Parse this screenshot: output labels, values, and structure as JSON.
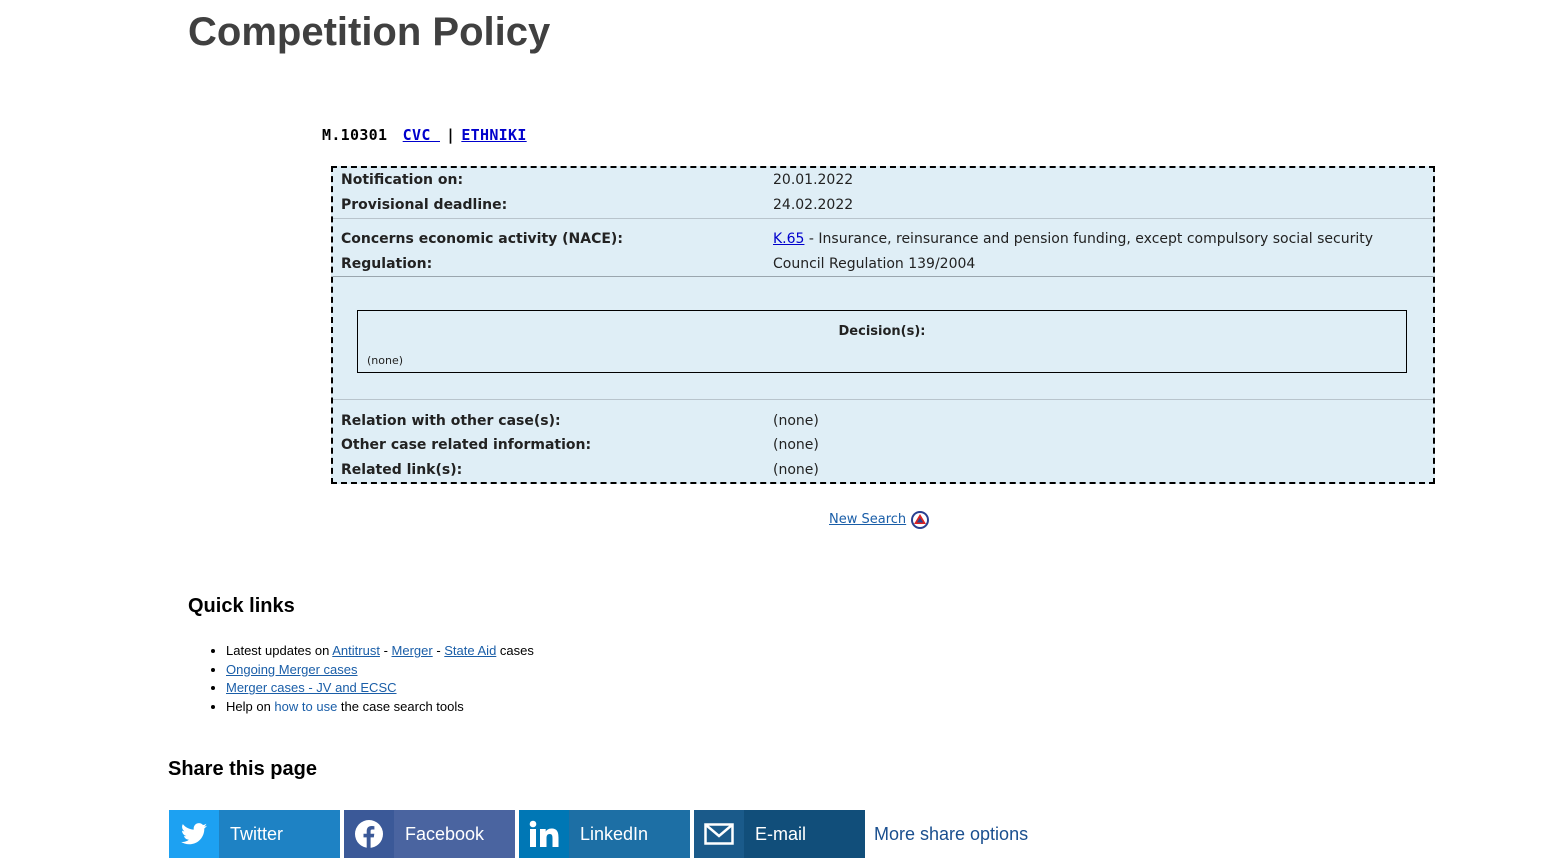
{
  "page": {
    "title": "Competition Policy"
  },
  "case": {
    "number": "M.10301",
    "party1": "CVC ",
    "separator": "|",
    "party2": "ETHNIKI",
    "notification_label": "Notification on:",
    "notification_value": "20.01.2022",
    "deadline_label": "Provisional deadline:",
    "deadline_value": "24.02.2022",
    "nace_label": "Concerns economic activity (NACE):",
    "nace_code": "K.65",
    "nace_desc": " - Insurance, reinsurance and pension funding, except compulsory social security",
    "regulation_label": "Regulation:",
    "regulation_value": "Council Regulation 139/2004",
    "decisions_title": "Decision(s):",
    "decisions_value": "(none)",
    "relation_label": "Relation with other case(s):",
    "relation_value": "(none)",
    "other_info_label": "Other case related information:",
    "other_info_value": "(none)",
    "related_links_label": "Related link(s):",
    "related_links_value": "(none)"
  },
  "new_search": {
    "label": "New Search",
    "icon": "triangle-up-icon"
  },
  "quick_links": {
    "heading": "Quick links",
    "item1_prefix": "Latest updates on ",
    "item1_antitrust": "Antitrust",
    "item1_sep1": " - ",
    "item1_merger": "Merger",
    "item1_sep2": " - ",
    "item1_stateaid": "State Aid",
    "item1_suffix": " cases",
    "item2": "Ongoing Merger cases",
    "item3": "Merger cases - JV and ECSC",
    "item4_prefix": "Help on ",
    "item4_link": "how to use",
    "item4_suffix": " the case search tools"
  },
  "share": {
    "heading": "Share this page",
    "buttons": [
      {
        "label": "Twitter",
        "icon": "twitter-icon",
        "color": "#1da1f2"
      },
      {
        "label": "Facebook",
        "icon": "facebook-icon",
        "color": "#3b5998"
      },
      {
        "label": "LinkedIn",
        "icon": "linkedin-icon",
        "color": "#0077b5"
      },
      {
        "label": "E-mail",
        "icon": "email-icon",
        "color": "#004494"
      }
    ],
    "more": "More share options"
  }
}
